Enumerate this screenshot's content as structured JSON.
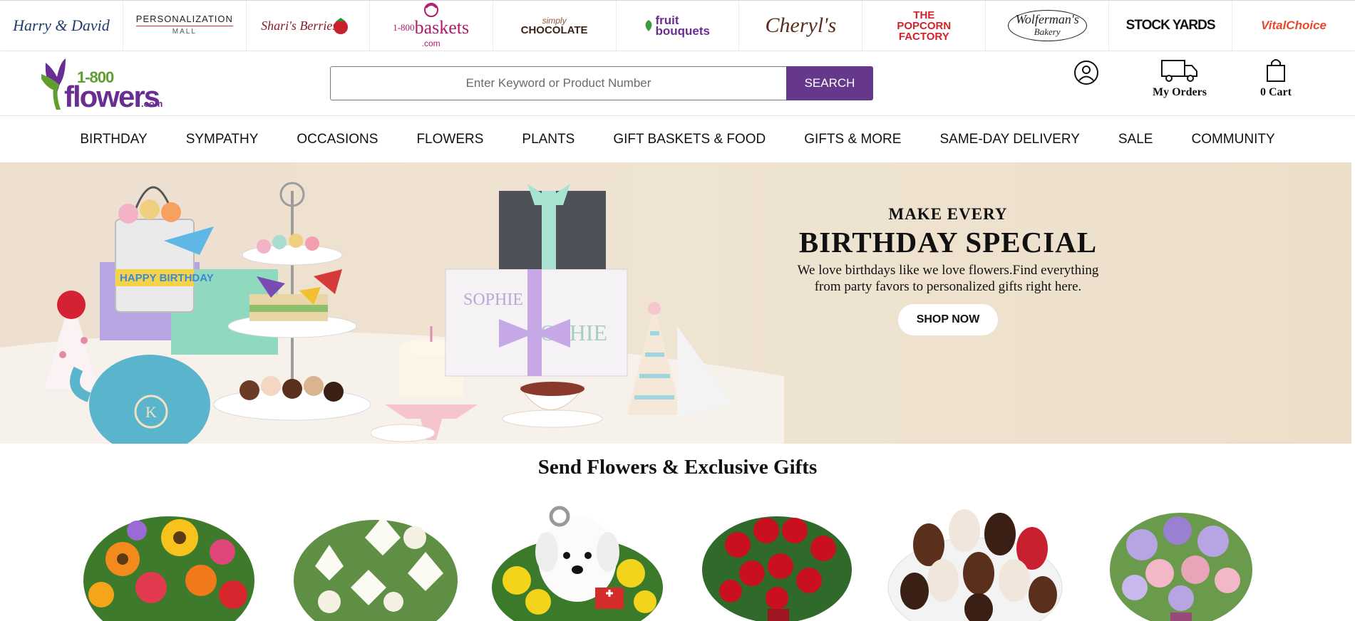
{
  "brands": [
    {
      "name": "Harry & David"
    },
    {
      "name": "PERSONALIZATION",
      "sub": "MALL"
    },
    {
      "name": "Shari's Berries"
    },
    {
      "name": "baskets",
      "sub": "1-800",
      "tail": ".com"
    },
    {
      "name": "CHOCOLATE",
      "sub": "simply"
    },
    {
      "name": "fruit bouquets"
    },
    {
      "name": "Cheryl's"
    },
    {
      "name": "THE POPCORN FACTORY"
    },
    {
      "name": "Wolferman's",
      "sub": "Bakery"
    },
    {
      "name": "STOCK YARDS"
    },
    {
      "name": "VitalChoice"
    }
  ],
  "header": {
    "logo": {
      "num": "1-800",
      "word": "flowers",
      "tld": ".com"
    },
    "search_placeholder": "Enter Keyword or Product Number",
    "search_button": "SEARCH",
    "orders_label": "My Orders",
    "cart_label": "0 Cart"
  },
  "nav": [
    "BIRTHDAY",
    "SYMPATHY",
    "OCCASIONS",
    "FLOWERS",
    "PLANTS",
    "GIFT BASKETS & FOOD",
    "GIFTS & MORE",
    "SAME-DAY DELIVERY",
    "SALE",
    "COMMUNITY"
  ],
  "hero": {
    "kicker": "MAKE EVERY",
    "title": "BIRTHDAY SPECIAL",
    "desc_line1": "We love birthdays like we love flowers.Find everything",
    "desc_line2": "from party favors to personalized gifts right here.",
    "button": "SHOP NOW",
    "cake_lettering": "HAPPY BIRTHDAY",
    "gift_name": "SOPHIE",
    "mug_initial": "K"
  },
  "section": {
    "title": "Send Flowers & Exclusive Gifts"
  },
  "products": [
    {
      "name": "mixed-bouquet",
      "kind": "Mixed sunflowers & roses"
    },
    {
      "name": "white-lilies",
      "kind": "White lilies"
    },
    {
      "name": "puppy-arrangement",
      "kind": "Puppy flower arrangement"
    },
    {
      "name": "red-roses",
      "kind": "Red roses"
    },
    {
      "name": "dipped-strawberries",
      "kind": "Chocolate dipped strawberries"
    },
    {
      "name": "pink-lavender-bouquet",
      "kind": "Pink & lavender bouquet"
    }
  ],
  "colors": {
    "brand_purple": "#65388b",
    "brand_green": "#5f9e2f",
    "hero_bg": "#eedfcf"
  }
}
